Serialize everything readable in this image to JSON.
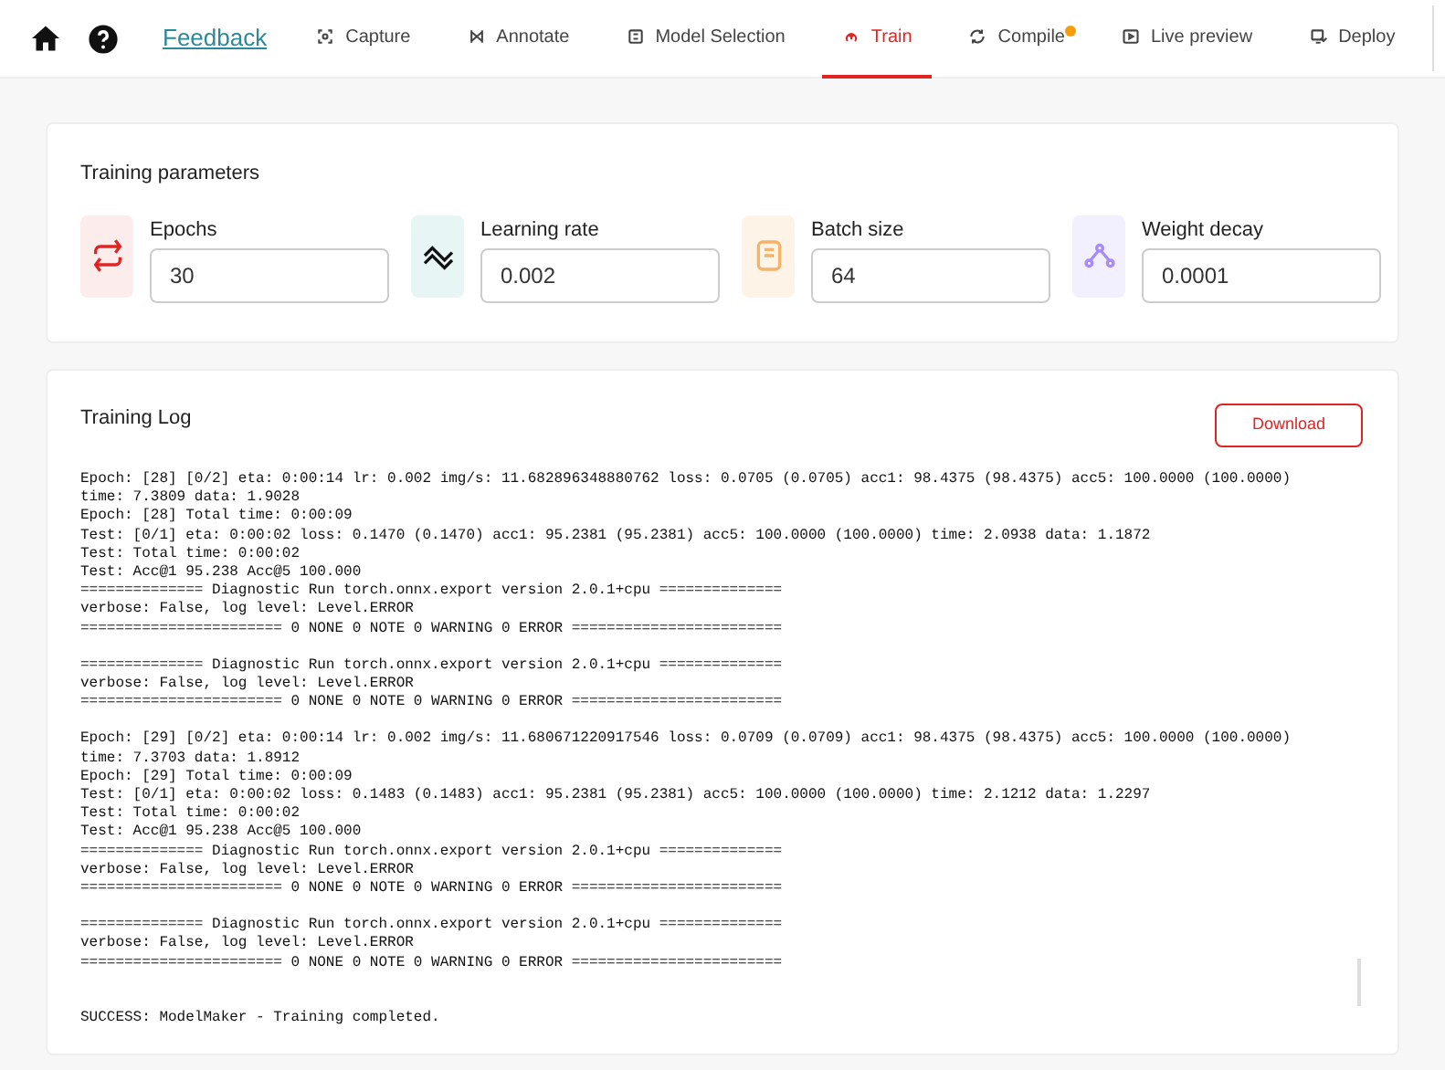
{
  "nav": {
    "feedback": "Feedback",
    "tabs": [
      {
        "label": "Capture",
        "selected": false,
        "badge": false
      },
      {
        "label": "Annotate",
        "selected": false,
        "badge": false
      },
      {
        "label": "Model Selection",
        "selected": false,
        "badge": false
      },
      {
        "label": "Train",
        "selected": true,
        "badge": false
      },
      {
        "label": "Compile",
        "selected": false,
        "badge": true
      },
      {
        "label": "Live preview",
        "selected": false,
        "badge": false
      },
      {
        "label": "Deploy",
        "selected": false,
        "badge": false
      }
    ]
  },
  "parameters": {
    "title": "Training parameters",
    "fields": [
      {
        "label": "Epochs",
        "value": "30",
        "color": "#e02424"
      },
      {
        "label": "Learning rate",
        "value": "0.002",
        "color": "#111111"
      },
      {
        "label": "Batch size",
        "value": "64",
        "color": "#f5b26b"
      },
      {
        "label": "Weight decay",
        "value": "0.0001",
        "color": "#a78bfa"
      }
    ]
  },
  "log": {
    "title": "Training Log",
    "download": "Download",
    "blocks": [
      {
        "kind": "block",
        "lines": [
          "Epoch: [28] [0/2] eta: 0:00:14 lr: 0.002 img/s: 11.682896348880762 loss: 0.0705 (0.0705) acc1: 98.4375 (98.4375) acc5: 100.0000 (100.0000)",
          "time: 7.3809 data: 1.9028",
          "Epoch: [28] Total time: 0:00:09",
          "Test: [0/1] eta: 0:00:02 loss: 0.1470 (0.1470) acc1: 95.2381 (95.2381) acc5: 100.0000 (100.0000) time: 2.0938 data: 1.1872",
          "Test: Total time: 0:00:02",
          "Test: Acc@1 95.238 Acc@5 100.000",
          "============== Diagnostic Run torch.onnx.export version 2.0.1+cpu ==============",
          "verbose: False, log level: Level.ERROR",
          "======================= 0 NONE 0 NOTE 0 WARNING 0 ERROR ========================"
        ]
      },
      {
        "kind": "block",
        "lines": [
          "============== Diagnostic Run torch.onnx.export version 2.0.1+cpu ==============",
          "verbose: False, log level: Level.ERROR",
          "======================= 0 NONE 0 NOTE 0 WARNING 0 ERROR ========================"
        ]
      },
      {
        "kind": "block",
        "lines": [
          "Epoch: [29] [0/2] eta: 0:00:14 lr: 0.002 img/s: 11.680671220917546 loss: 0.0709 (0.0709) acc1: 98.4375 (98.4375) acc5: 100.0000 (100.0000)",
          "time: 7.3703 data: 1.8912",
          "Epoch: [29] Total time: 0:00:09",
          "Test: [0/1] eta: 0:00:02 loss: 0.1483 (0.1483) acc1: 95.2381 (95.2381) acc5: 100.0000 (100.0000) time: 2.1212 data: 1.2297",
          "Test: Total time: 0:00:02",
          "Test: Acc@1 95.238 Acc@5 100.000",
          "============== Diagnostic Run torch.onnx.export version 2.0.1+cpu ==============",
          "verbose: False, log level: Level.ERROR",
          "======================= 0 NONE 0 NOTE 0 WARNING 0 ERROR ========================"
        ]
      },
      {
        "kind": "block",
        "lines": [
          "============== Diagnostic Run torch.onnx.export version 2.0.1+cpu ==============",
          "verbose: False, log level: Level.ERROR",
          "======================= 0 NONE 0 NOTE 0 WARNING 0 ERROR ========================"
        ]
      },
      {
        "kind": "status",
        "lines": [
          "SUCCESS: ModelMaker - Training completed."
        ]
      }
    ]
  }
}
